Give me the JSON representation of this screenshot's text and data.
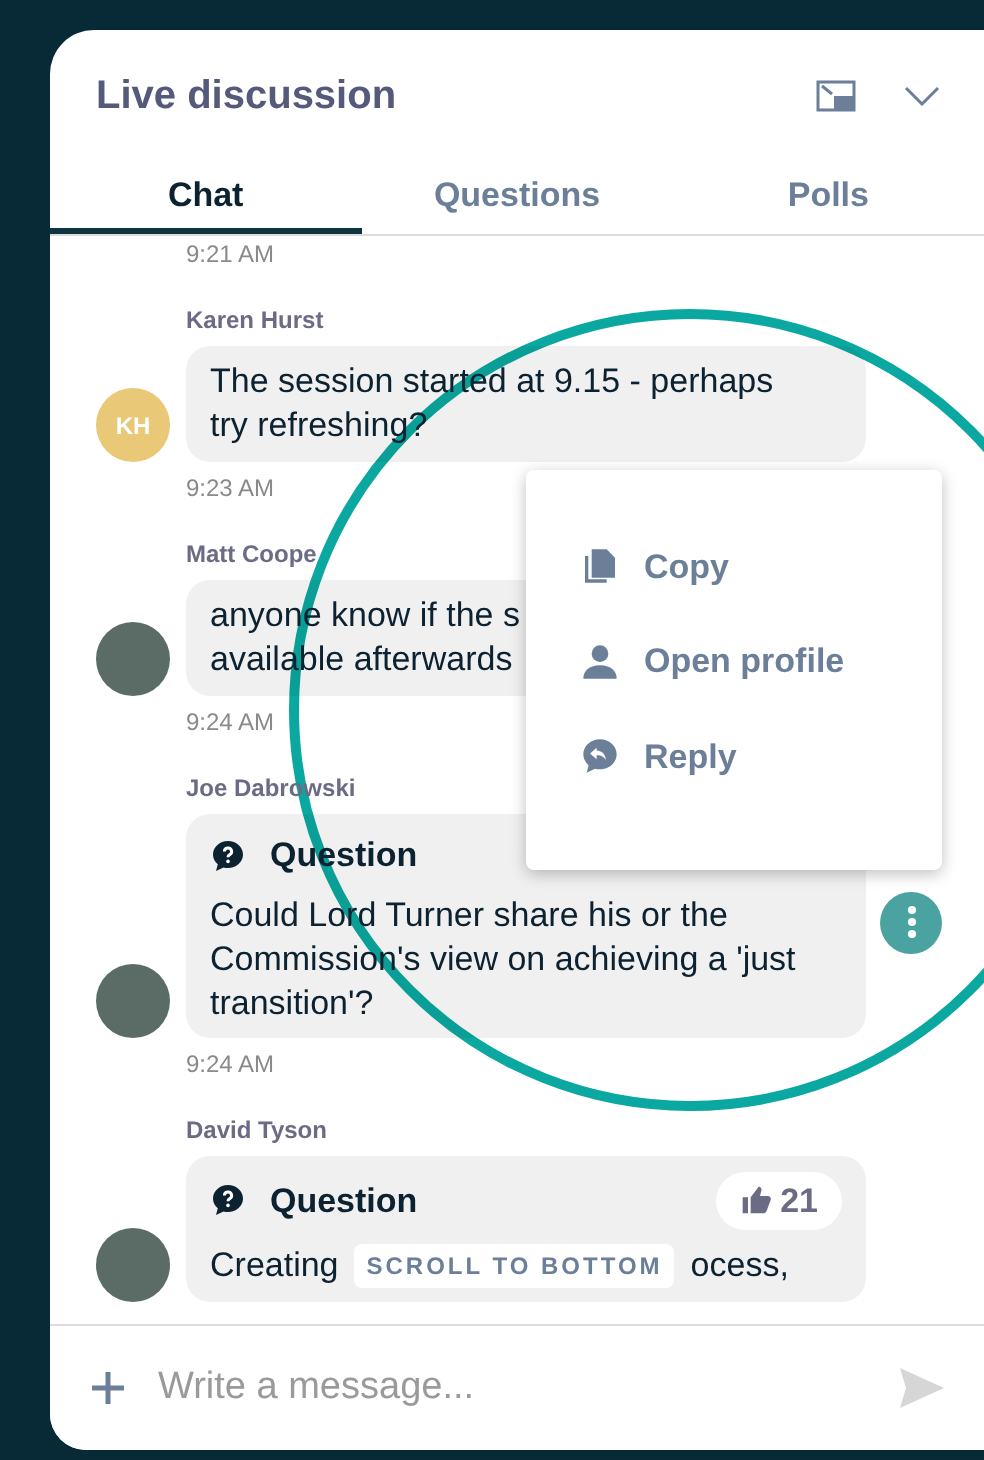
{
  "header": {
    "title": "Live discussion"
  },
  "tabs": [
    {
      "label": "Chat",
      "selected": true
    },
    {
      "label": "Questions",
      "selected": false
    },
    {
      "label": "Polls",
      "selected": false
    }
  ],
  "messages": [
    {
      "kind": "partial",
      "time": "9:21 AM"
    },
    {
      "kind": "text",
      "author": "Karen Hurst",
      "initials": "KH",
      "lines": [
        "The session started at 9.15 - perhaps",
        "try refreshing?"
      ],
      "time": "9:23 AM"
    },
    {
      "kind": "text",
      "author": "Matt Coope",
      "lines": [
        "anyone know if the s",
        "available afterwards"
      ],
      "time": "9:24 AM"
    },
    {
      "kind": "question",
      "author": "Joe Dabrowski",
      "label": "Question",
      "text": "Could Lord Turner share his or the Commission's view on achieving a 'just transition'?",
      "time": "9:24 AM",
      "menu_open": true
    },
    {
      "kind": "question",
      "author": "David Tyson",
      "label": "Question",
      "likes": "21",
      "text_before": "Creating",
      "text_after": "ocess,"
    }
  ],
  "scroll_button": "SCROLL TO BOTTOM",
  "context_menu": [
    {
      "label": "Copy"
    },
    {
      "label": "Open profile"
    },
    {
      "label": "Reply"
    }
  ],
  "composer": {
    "placeholder": "Write a message..."
  }
}
